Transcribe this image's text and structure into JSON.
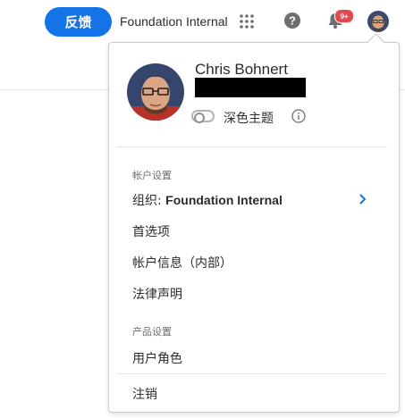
{
  "header": {
    "feedback_label": "反馈",
    "org_name": "Foundation Internal",
    "notification_count": "9+",
    "icons": [
      "apps-grid-icon",
      "help-icon",
      "bell-icon"
    ]
  },
  "profile": {
    "name": "Chris Bohnert",
    "dark_theme_label": "深色主题",
    "dark_theme_enabled": false
  },
  "account_settings": {
    "section_label": "帐户设置",
    "org_prefix": "组织:",
    "org_value": "Foundation Internal",
    "preferences": "首选项",
    "account_info": "帐户信息（内部）",
    "legal": "法律声明"
  },
  "product_settings": {
    "section_label": "产品设置",
    "user_roles": "用户角色"
  },
  "sign_out": "注销",
  "colors": {
    "accent": "#1473e6",
    "badge": "#e34850",
    "chevron": "#1473e6"
  }
}
